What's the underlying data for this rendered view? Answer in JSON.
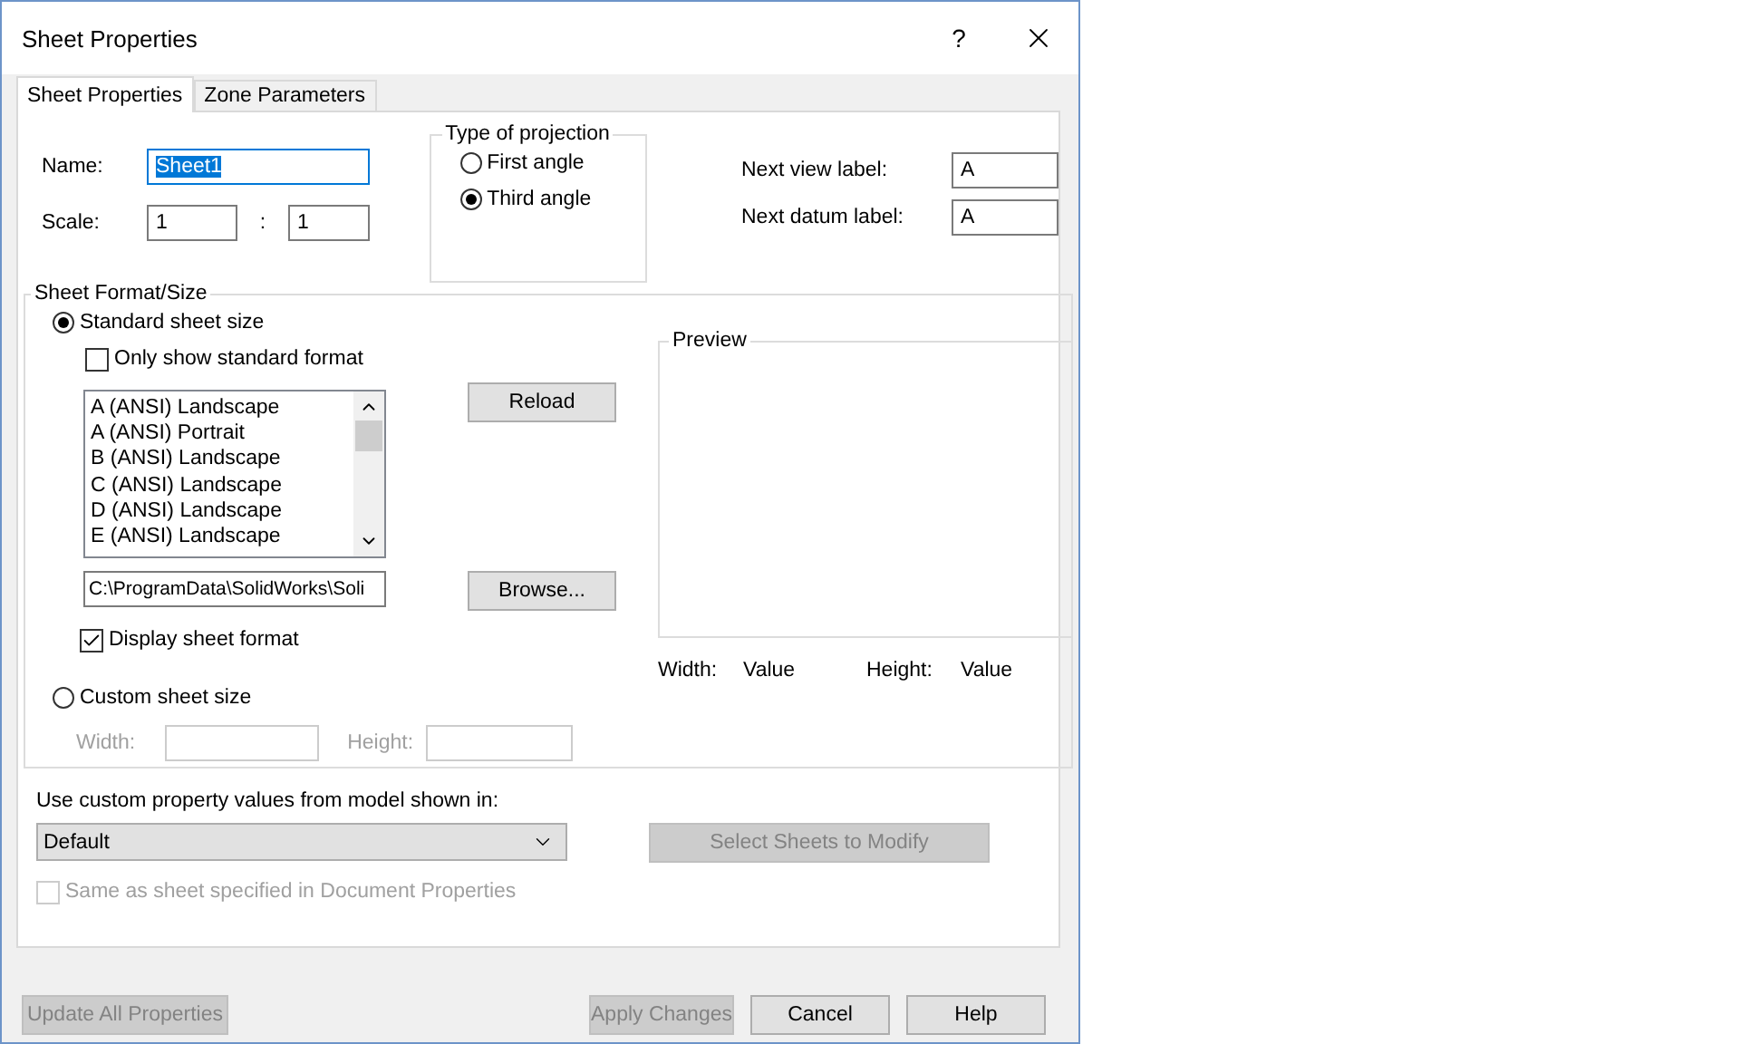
{
  "window": {
    "title": "Sheet Properties",
    "help": "?"
  },
  "tabs": [
    {
      "label": "Sheet Properties",
      "selected": true
    },
    {
      "label": "Zone Parameters",
      "selected": false
    }
  ],
  "name": {
    "label": "Name:",
    "value": "Sheet1",
    "value_selected": true
  },
  "scale": {
    "label": "Scale:",
    "numerator": "1",
    "separator": ":",
    "denominator": "1"
  },
  "projection": {
    "title": "Type of projection",
    "options": [
      {
        "label": "First angle",
        "selected": false
      },
      {
        "label": "Third angle",
        "selected": true
      }
    ]
  },
  "next_labels": [
    {
      "label": "Next view label:",
      "value": "A"
    },
    {
      "label": "Next datum label:",
      "value": "A"
    }
  ],
  "sheet_format": {
    "title": "Sheet Format/Size",
    "standard": {
      "label": "Standard sheet size",
      "selected": true
    },
    "only_standard": {
      "label": "Only show standard format",
      "checked": false
    },
    "formats": [
      "A (ANSI) Landscape",
      "A (ANSI) Portrait",
      "B (ANSI) Landscape",
      "C (ANSI) Landscape",
      "D (ANSI) Landscape",
      "E (ANSI) Landscape"
    ],
    "reload": "Reload",
    "path": "C:\\ProgramData\\SolidWorks\\Soli",
    "browse": "Browse...",
    "display_format": {
      "label": "Display sheet format",
      "checked": true
    },
    "preview": {
      "title": "Preview",
      "width_label": "Width:",
      "width_value": "Value",
      "height_label": "Height:",
      "height_value": "Value"
    },
    "custom": {
      "label": "Custom sheet size",
      "selected": false,
      "width_label": "Width:",
      "height_label": "Height:",
      "disabled": true
    }
  },
  "custom_property": {
    "label": "Use custom property values from model shown in:",
    "value": "Default",
    "select_sheets": {
      "label": "Select Sheets to Modify",
      "disabled": true
    },
    "same_as": {
      "label": "Same as sheet specified in Document Properties",
      "checked": false,
      "disabled": true
    }
  },
  "footer_buttons": [
    {
      "label": "Update All Properties",
      "disabled": true
    },
    {
      "label": "Apply Changes",
      "disabled": true
    },
    {
      "label": "Cancel",
      "disabled": false
    },
    {
      "label": "Help",
      "disabled": false
    }
  ]
}
